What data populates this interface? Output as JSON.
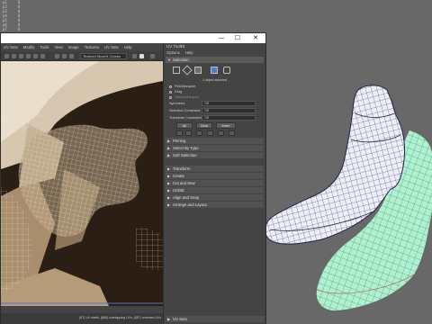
{
  "background_viewport": {
    "outliner_rows": [
      {
        "name": "p1",
        "val": "0"
      },
      {
        "name": "p2",
        "val": "0"
      },
      {
        "name": "p3",
        "val": "0"
      },
      {
        "name": "p4",
        "val": "0"
      },
      {
        "name": "p5",
        "val": "0"
      },
      {
        "name": "p6",
        "val": "0"
      },
      {
        "name": "p7",
        "val": "0"
      }
    ]
  },
  "uv_editor": {
    "window_controls": {
      "minimize": "—",
      "maximize": "☐",
      "close": "✕"
    },
    "menu": [
      "UV Sets",
      "Modify",
      "Tools",
      "View",
      "Image",
      "Textures",
      "UV Sets",
      "Help"
    ],
    "texture_combo": "Textured Shoe01 Combo",
    "status_text": "(87) UV shells, (865) overlapping UVs, (857) reversed UVs"
  },
  "uv_toolkit": {
    "title": "UV Toolkit",
    "menu": [
      "Options",
      "Help"
    ],
    "sections": {
      "selection": "Selection",
      "pinning": "Pinning",
      "select_by_type": "Select By Type",
      "soft_selection": "Soft Selection",
      "transform": "Transform",
      "create": "Create",
      "cut_and_sew": "Cut and Sew",
      "unfold": "Unfold",
      "align_and_snap": "Align and Snap",
      "arrange_and_layout": "Arrange and Layout",
      "uv_sets": "UV Sets"
    },
    "selection_count": "1 object selected",
    "radio": [
      "Pick/Marquee",
      "Drag",
      "Tweak/Marquee"
    ],
    "fields": [
      {
        "label": "Symmetry:",
        "value": "Off"
      },
      {
        "label": "Selection Constraint:",
        "value": "Off"
      },
      {
        "label": "Transform Constraint:",
        "value": "Off"
      }
    ],
    "buttons": [
      "All",
      "Clear",
      "Invert"
    ]
  }
}
